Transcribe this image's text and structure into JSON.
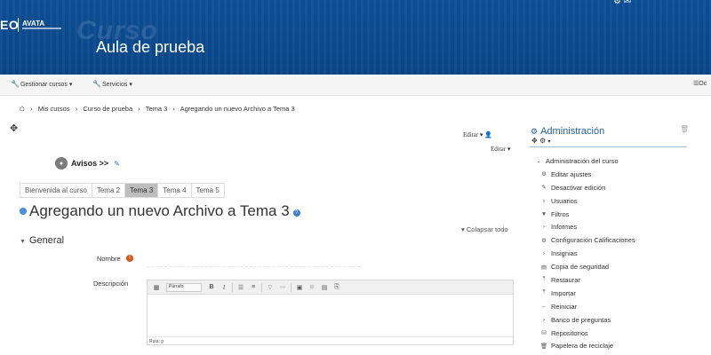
{
  "header": {
    "logo_main": "EO",
    "logo_avata": "AVATA",
    "ghost_title": "Curso",
    "course_title": "Aula de prueba"
  },
  "navbar": {
    "manage_courses": "Gestionar cursos",
    "services": "Servicios",
    "right_label": "Oc"
  },
  "breadcrumb": [
    "Mis cursos",
    "Curso de prueba",
    "Tema 3",
    "Agregando un nuevo Archivo a Tema 3"
  ],
  "content": {
    "editar": "Editar",
    "avisos_label": "Avisos >>",
    "tabs": [
      {
        "label": "Bienvenida al curso",
        "active": false
      },
      {
        "label": "Tema 2",
        "active": false
      },
      {
        "label": "Tema 3",
        "active": true
      },
      {
        "label": "Tema 4",
        "active": false
      },
      {
        "label": "Tema 5",
        "active": false
      }
    ],
    "heading": "Agregando un nuevo Archivo a Tema 3",
    "collapse_all": "Colapsar todo",
    "section_general": "General",
    "label_name": "Nombre",
    "label_description": "Descripción",
    "editor_format": "Párrafo",
    "editor_status": "Ruta: p"
  },
  "admin": {
    "title": "Administración",
    "items": [
      {
        "label": "Administración del curso",
        "icon": "chevron-down-icon",
        "level": "root"
      },
      {
        "label": "Editar ajustes",
        "icon": "gear-icon",
        "level": "child"
      },
      {
        "label": "Desactivar edición",
        "icon": "pencil-icon",
        "level": "child"
      },
      {
        "label": "Usuarios",
        "icon": "chevron-right-icon",
        "level": "child"
      },
      {
        "label": "Filtros",
        "icon": "filter-icon",
        "level": "child"
      },
      {
        "label": "Informes",
        "icon": "chevron-right-icon",
        "level": "child"
      },
      {
        "label": "Configuración Calificaciones",
        "icon": "gear-icon",
        "level": "child"
      },
      {
        "label": "Insignias",
        "icon": "chevron-right-icon",
        "level": "child"
      },
      {
        "label": "Copia de seguridad",
        "icon": "file-icon",
        "level": "child"
      },
      {
        "label": "Restaurar",
        "icon": "upload-icon",
        "level": "child"
      },
      {
        "label": "Importar",
        "icon": "upload-icon",
        "level": "child"
      },
      {
        "label": "Reiniciar",
        "icon": "arrow-left-icon",
        "level": "child"
      },
      {
        "label": "Banco de preguntas",
        "icon": "chevron-right-icon",
        "level": "child"
      },
      {
        "label": "Repositorios",
        "icon": "database-icon",
        "level": "child"
      },
      {
        "label": "Papelera de reciclaje",
        "icon": "trash-icon",
        "level": "child"
      }
    ]
  },
  "colors": {
    "header_blue": "#0b4a8f",
    "link_blue": "#1f5f9f",
    "active_tab": "#bdbdbd"
  }
}
